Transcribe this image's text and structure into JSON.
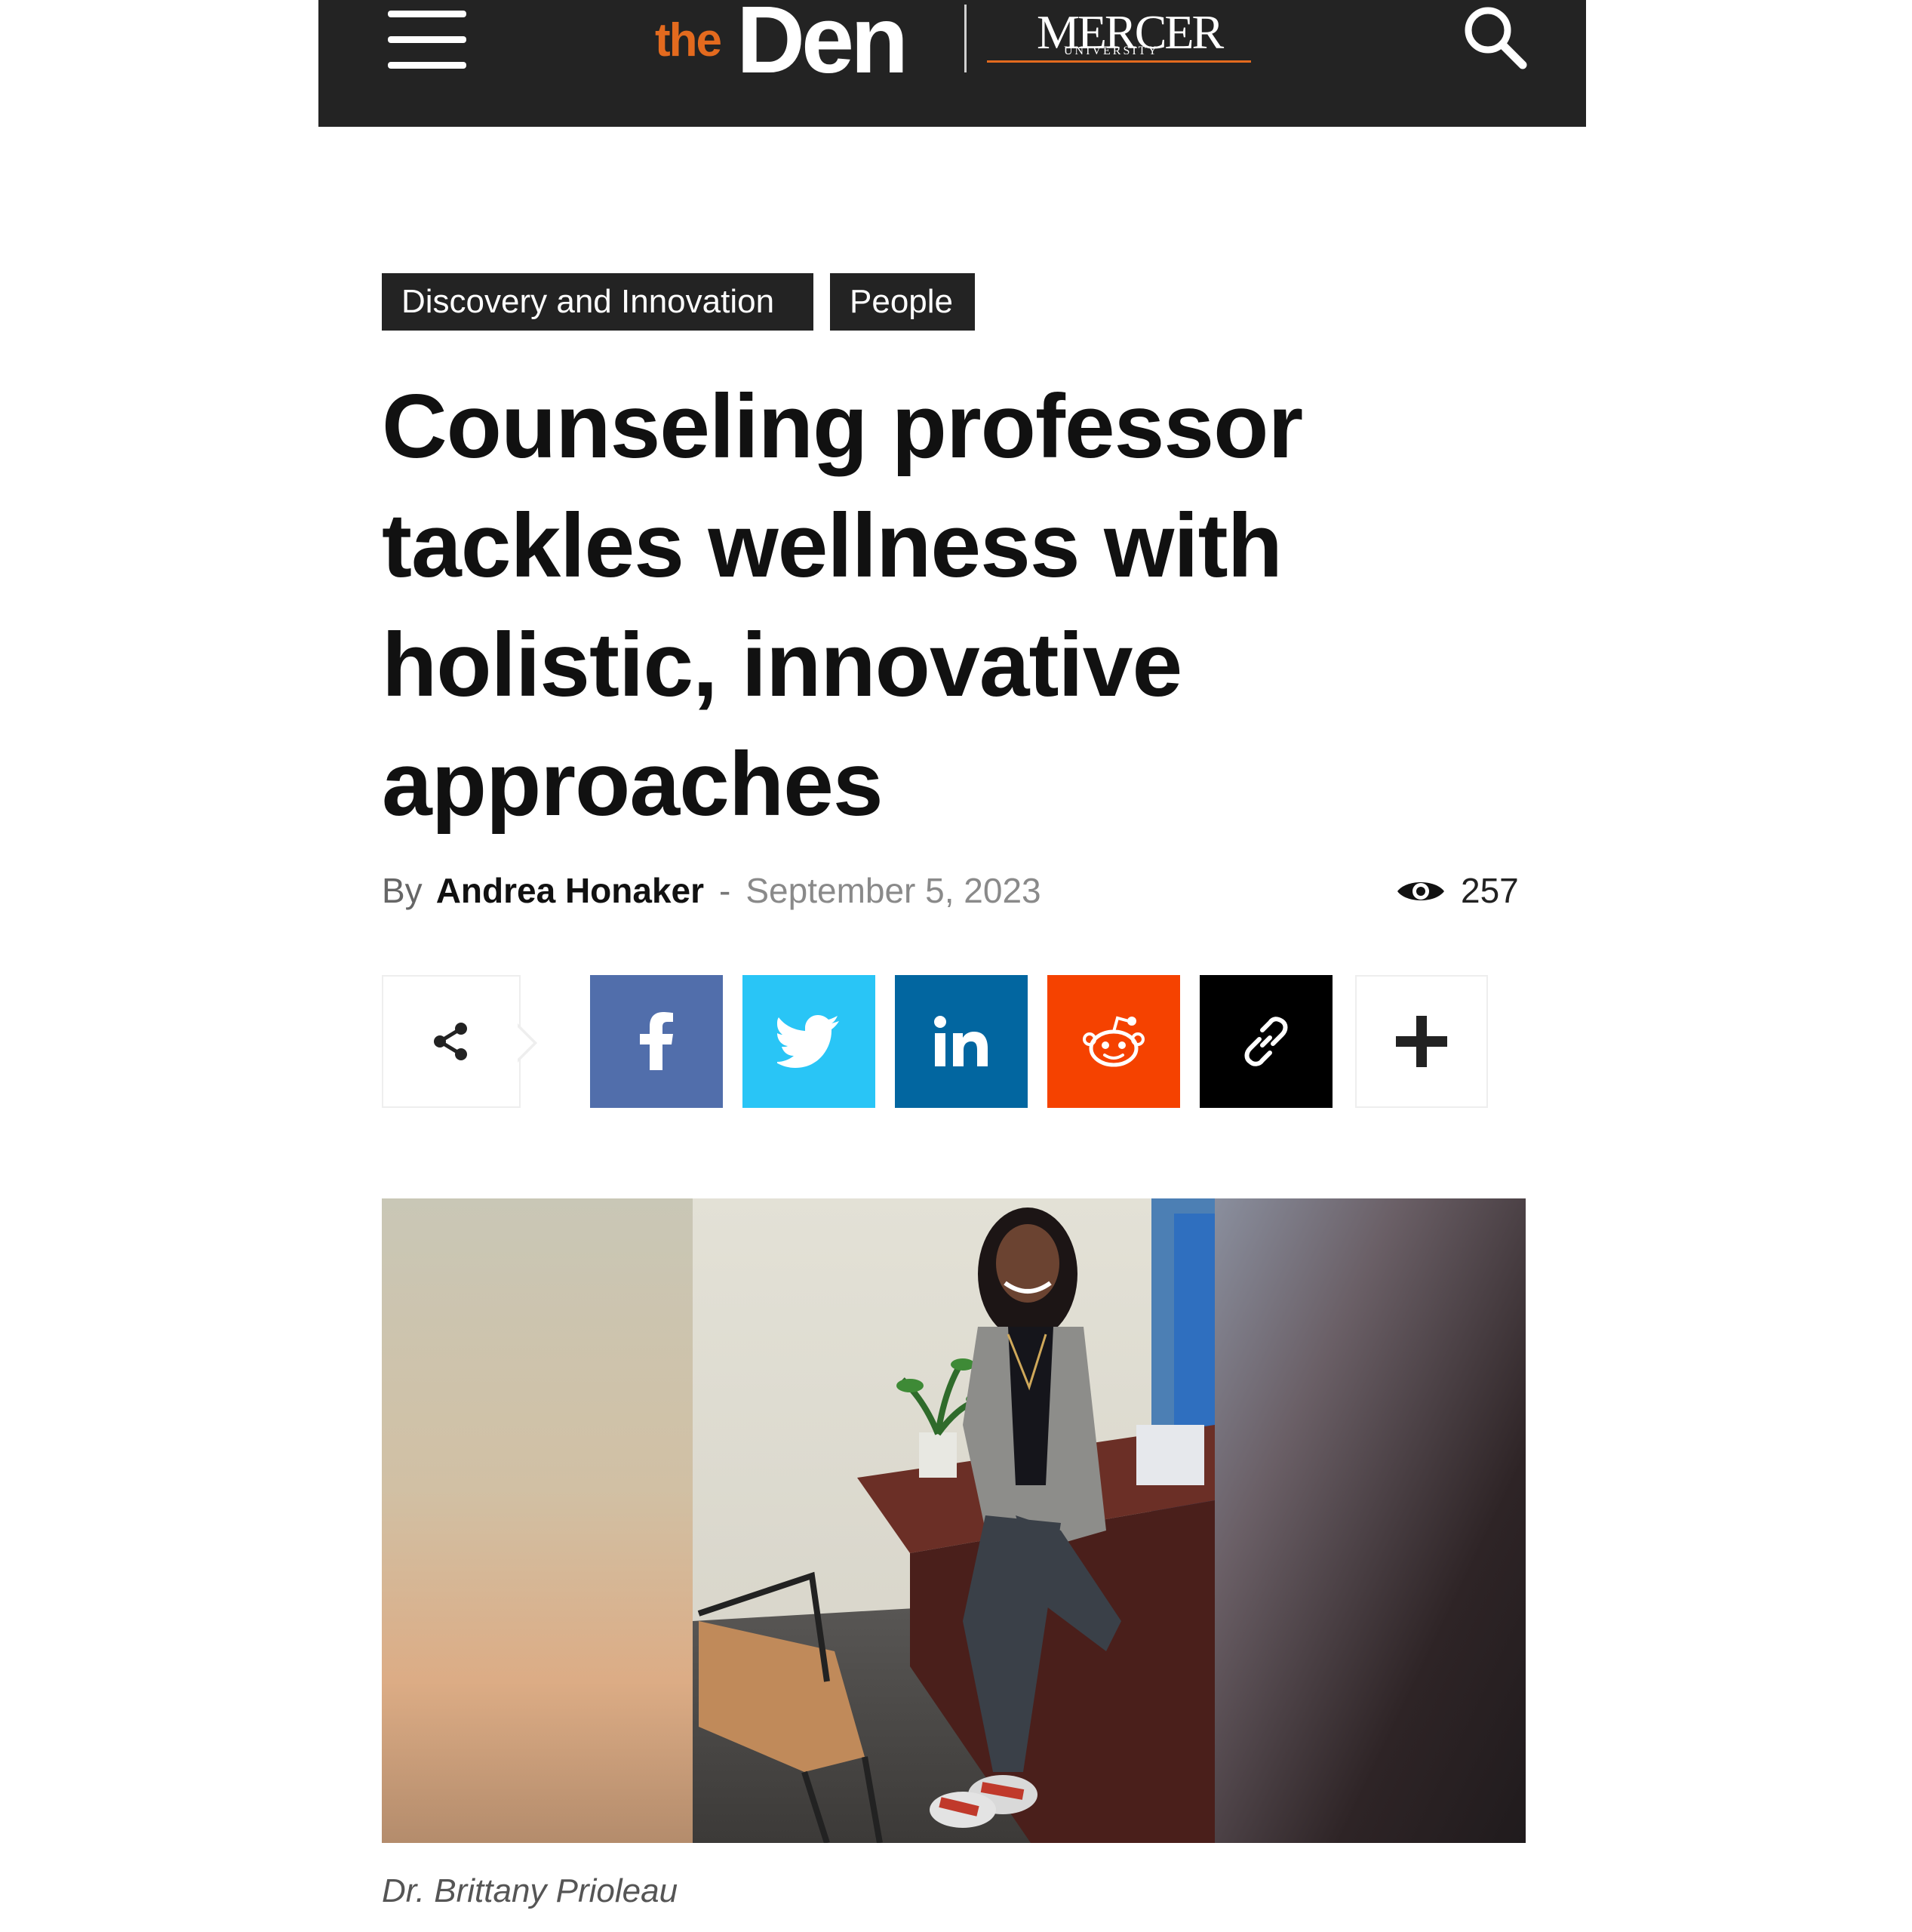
{
  "header": {
    "logo_the": "the",
    "logo_den": "Den",
    "logo_mercer": "MERCER",
    "logo_university": "UNIVERSITY",
    "menu_icon": "hamburger-menu-icon",
    "search_icon": "search-icon"
  },
  "article": {
    "categories": [
      "Discovery and Innovation",
      "People"
    ],
    "title": "Counseling professor tackles wellness with holistic, innovative approaches",
    "by_label": "By",
    "author": "Andrea Honaker",
    "separator": "-",
    "date": "September 5, 2023",
    "views": "257",
    "caption": "Dr. Brittany Prioleau"
  },
  "share": {
    "buttons": [
      {
        "name": "share",
        "icon": "share-icon"
      },
      {
        "name": "facebook",
        "icon": "facebook-icon",
        "color": "#516eab"
      },
      {
        "name": "twitter",
        "icon": "twitter-icon",
        "color": "#29c5f6"
      },
      {
        "name": "linkedin",
        "icon": "linkedin-icon",
        "color": "#0266a0"
      },
      {
        "name": "reddit",
        "icon": "reddit-icon",
        "color": "#f54200"
      },
      {
        "name": "copy-link",
        "icon": "link-icon",
        "color": "#000000"
      },
      {
        "name": "more",
        "icon": "plus-icon"
      }
    ]
  },
  "colors": {
    "header_bg": "#232323",
    "accent": "#e36a1e",
    "tag_bg": "#232323"
  }
}
